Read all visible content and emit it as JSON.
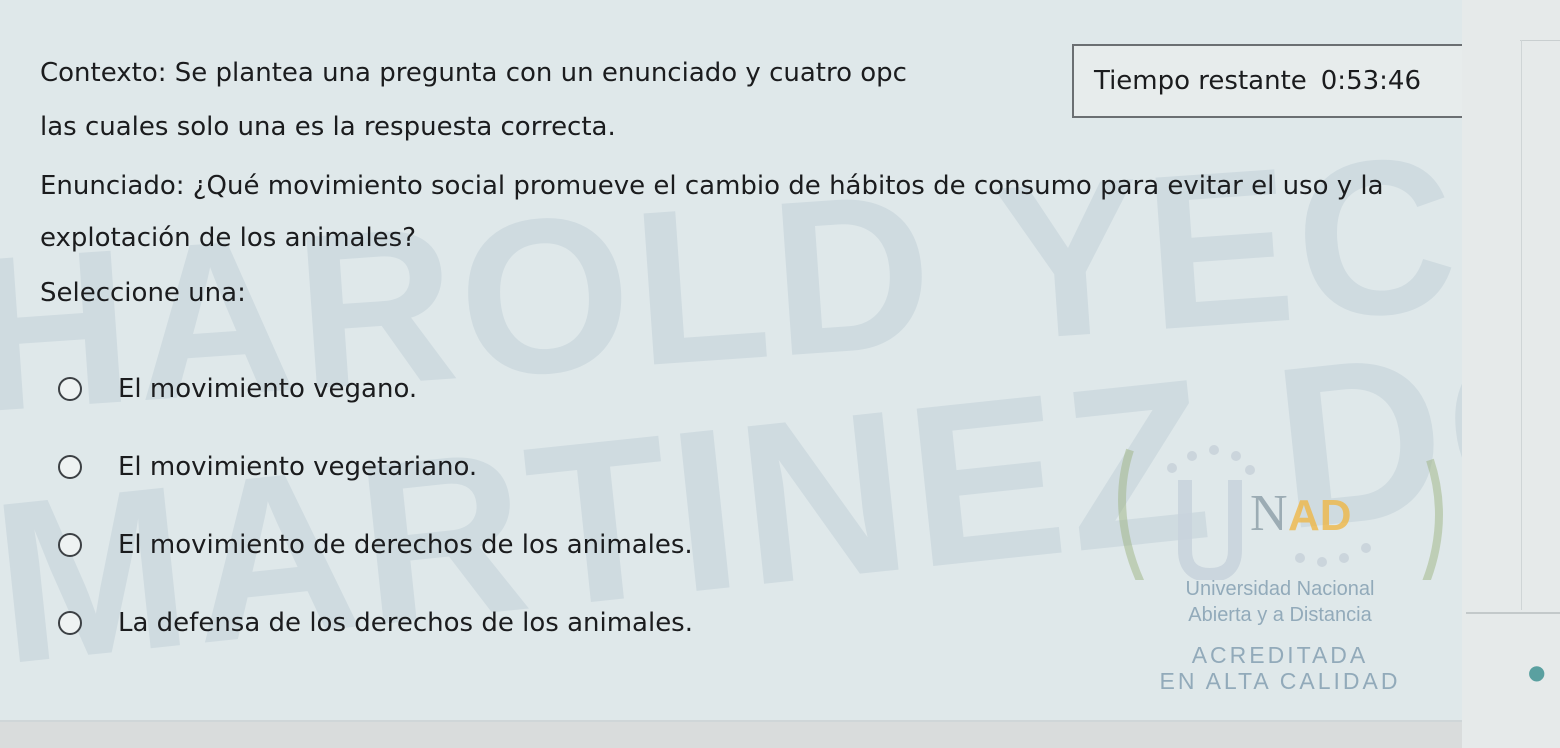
{
  "question": {
    "context_line1": "Contexto: Se plantea una pregunta con un enunciado y cuatro opc",
    "context_line2": "las cuales solo una es la respuesta correcta.",
    "statement": "Enunciado: ¿Qué movimiento social promueve el cambio de hábitos de consumo para evitar el uso y la explotación de los animales?",
    "select_label": "Seleccione una:",
    "options": [
      {
        "label": "El movimiento vegano.",
        "selected": false
      },
      {
        "label": "El movimiento vegetariano.",
        "selected": false
      },
      {
        "label": "El movimiento de derechos de los animales.",
        "selected": false
      },
      {
        "label": "La defensa de los derechos de los animales.",
        "selected": false
      }
    ]
  },
  "timer": {
    "label": "Tiempo restante",
    "value": "0:53:46"
  },
  "watermark": {
    "line1": "HAROLD YECID",
    "line2": "MARTINEZ DONADO"
  },
  "logo": {
    "brand": "UNAD",
    "line1": "Universidad Nacional",
    "line2": "Abierta y a Distancia",
    "line3": "ACREDITADA",
    "line4": "EN ALTA CALIDAD"
  },
  "colors": {
    "panel_bg": "#dfe8ea",
    "watermark": "#96afbe",
    "logo_accent": "#f0b43c"
  }
}
